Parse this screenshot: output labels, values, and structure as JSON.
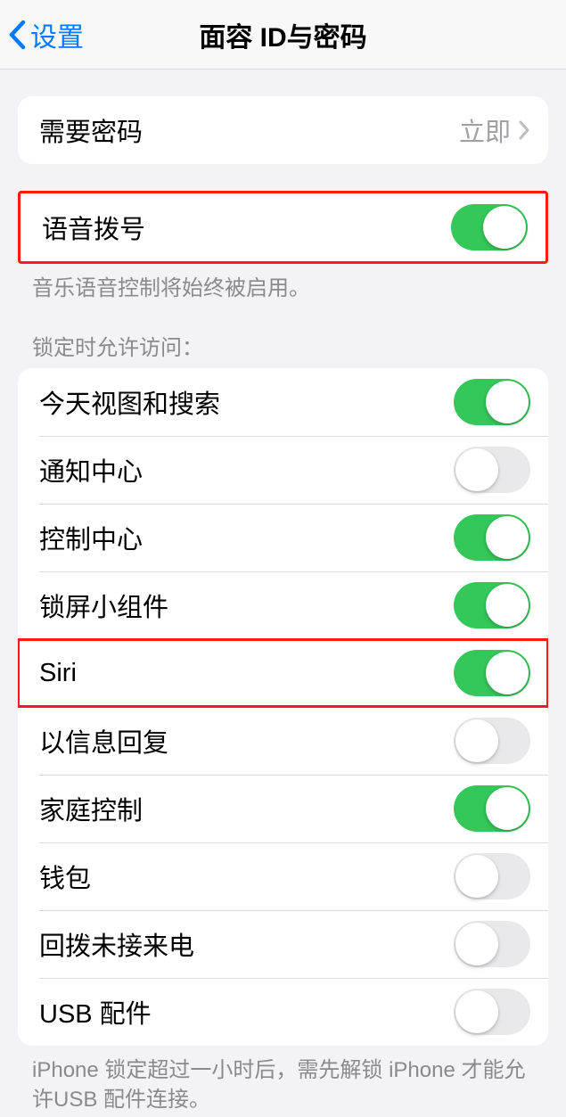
{
  "nav": {
    "back_label": "设置",
    "title": "面容 ID与密码"
  },
  "group_passcode": {
    "require_passcode_label": "需要密码",
    "require_passcode_value": "立即"
  },
  "group_voice": {
    "voice_dial_label": "语音拨号",
    "voice_dial_on": true,
    "footer": "音乐语音控制将始终被启用。"
  },
  "group_locked_header": "锁定时允许访问：",
  "group_locked_items": [
    {
      "label": "今天视图和搜索",
      "on": true,
      "highlighted": false
    },
    {
      "label": "通知中心",
      "on": false,
      "highlighted": false
    },
    {
      "label": "控制中心",
      "on": true,
      "highlighted": false
    },
    {
      "label": "锁屏小组件",
      "on": true,
      "highlighted": false
    },
    {
      "label": "Siri",
      "on": true,
      "highlighted": true
    },
    {
      "label": "以信息回复",
      "on": false,
      "highlighted": false
    },
    {
      "label": "家庭控制",
      "on": true,
      "highlighted": false
    },
    {
      "label": "钱包",
      "on": false,
      "highlighted": false
    },
    {
      "label": "回拨未接来电",
      "on": false,
      "highlighted": false
    },
    {
      "label": "USB 配件",
      "on": false,
      "highlighted": false
    }
  ],
  "group_locked_footer": "iPhone 锁定超过一小时后，需先解锁 iPhone 才能允许USB 配件连接。"
}
